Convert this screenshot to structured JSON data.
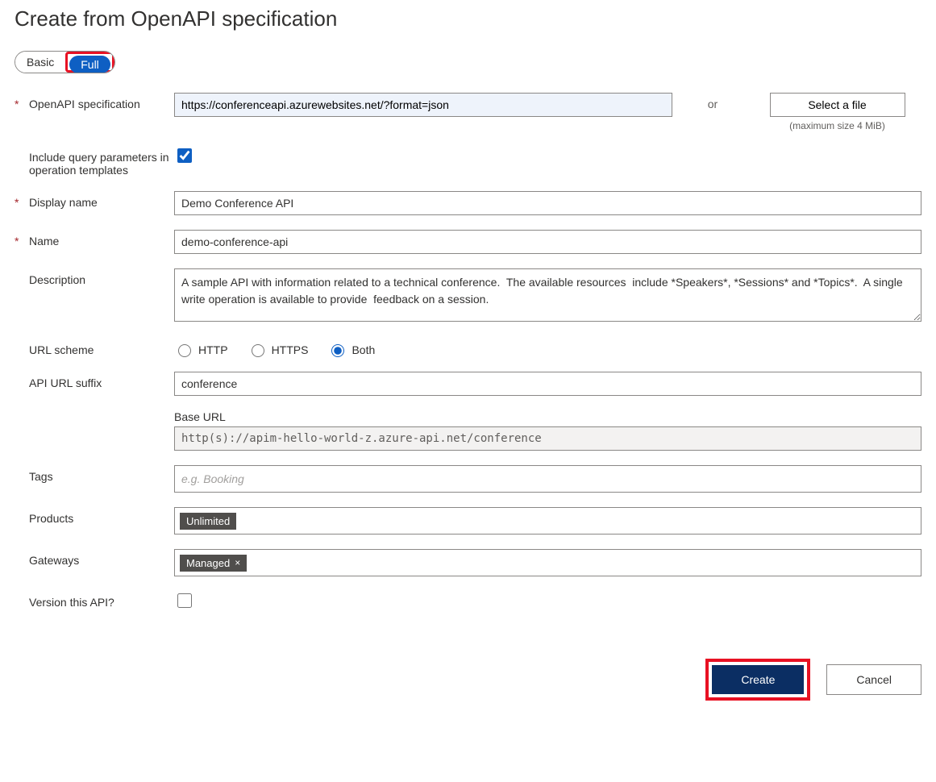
{
  "title": "Create from OpenAPI specification",
  "toggle": {
    "basic": "Basic",
    "full": "Full"
  },
  "fields": {
    "openapi_spec": {
      "label": "OpenAPI specification",
      "value": "https://conferenceapi.azurewebsites.net/?format=json",
      "or": "or",
      "file_btn": "Select a file",
      "file_hint": "(maximum size 4 MiB)"
    },
    "include_query": {
      "label": "Include query parameters in operation templates",
      "checked": true
    },
    "display_name": {
      "label": "Display name",
      "value": "Demo Conference API"
    },
    "name": {
      "label": "Name",
      "value": "demo-conference-api"
    },
    "description": {
      "label": "Description",
      "value": "A sample API with information related to a technical conference.  The available resources  include *Speakers*, *Sessions* and *Topics*.  A single write operation is available to provide  feedback on a session."
    },
    "url_scheme": {
      "label": "URL scheme",
      "options": {
        "http": "HTTP",
        "https": "HTTPS",
        "both": "Both"
      },
      "selected": "both"
    },
    "api_url_suffix": {
      "label": "API URL suffix",
      "value": "conference"
    },
    "base_url": {
      "label": "Base URL",
      "value": "http(s)://apim-hello-world-z.azure-api.net/conference"
    },
    "tags": {
      "label": "Tags",
      "placeholder": "e.g. Booking"
    },
    "products": {
      "label": "Products",
      "chip": "Unlimited"
    },
    "gateways": {
      "label": "Gateways",
      "chip": "Managed"
    },
    "version": {
      "label": "Version this API?",
      "checked": false
    }
  },
  "buttons": {
    "create": "Create",
    "cancel": "Cancel"
  }
}
